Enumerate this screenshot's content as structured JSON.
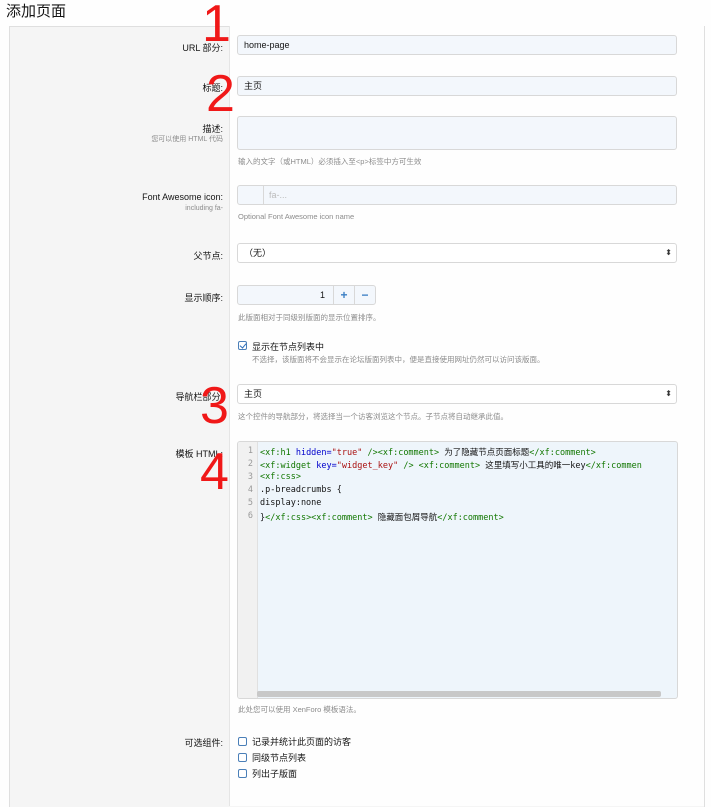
{
  "page": {
    "title": "添加页面"
  },
  "fields": {
    "url": {
      "label": "URL 部分:",
      "value": "home-page"
    },
    "title": {
      "label": "标题:",
      "value": "主页"
    },
    "description": {
      "label": "描述:",
      "hint_left": "您可以使用 HTML 代码",
      "value": "",
      "hint": "输入的文字（或HTML）必须插入至<p>标签中方可生效"
    },
    "icon": {
      "label": "Font Awesome icon:",
      "hint_left": "including fa-",
      "placeholder": "fa-...",
      "hint": "Optional Font Awesome icon name"
    },
    "parent": {
      "label": "父节点:",
      "value": "（无）"
    },
    "order": {
      "label": "显示顺序:",
      "value": "1",
      "plus": "+",
      "minus": "−",
      "hint": "此版面相对于同级别版面的显示位置排序。"
    },
    "show_in_list": {
      "label": "显示在节点列表中",
      "checked": true,
      "desc": "不选择，该版面将不会显示在论坛版面列表中，便是直接使用网址仍然可以访问该版面。"
    },
    "nav_section": {
      "label": "导航栏部分:",
      "value": "主页",
      "hint": "这个控件的导航部分，将选择当一个访客浏览这个节点。子节点将自动继承此值。"
    },
    "template": {
      "label": "模板 HTML:",
      "hint": "此处您可以使用 XenForo 模板语法。",
      "line_numbers": [
        "1",
        "2",
        "3",
        "4",
        "5",
        "6"
      ]
    },
    "options": {
      "label": "可选组件:",
      "items": [
        {
          "label": "记录并统计此页面的访客",
          "checked": false
        },
        {
          "label": "同级节点列表",
          "checked": false
        },
        {
          "label": "列出子版面",
          "checked": false
        }
      ]
    }
  },
  "code": {
    "l1_tag_open": "<xf:h1 ",
    "l1_attr": "hidden=",
    "l1_str": "\"true\"",
    "l1_tag_close": " /><xf:comment>",
    "l1_text": " 为了隐藏节点页面标题",
    "l1_tag_end": "</xf:comment>",
    "l2_tag_open": "<xf:widget ",
    "l2_attr": "key=",
    "l2_str": "\"widget_key\"",
    "l2_tag_close": " /> <xf:comment>",
    "l2_text": " 这里填写小工具的唯一key",
    "l2_tag_end": "</xf:commen",
    "l3": "<xf:css>",
    "l4": ".p-breadcrumbs {",
    "l5": "display:none",
    "l6_a": "}",
    "l6_tag": "</xf:css><xf:comment>",
    "l6_text": " 隐藏面包屑导航",
    "l6_tag_end": "</xf:comment>"
  },
  "annotations": [
    "1",
    "2",
    "3",
    "4"
  ],
  "colors": {
    "annotation": "#f01818",
    "accent": "#3b7fc4"
  }
}
